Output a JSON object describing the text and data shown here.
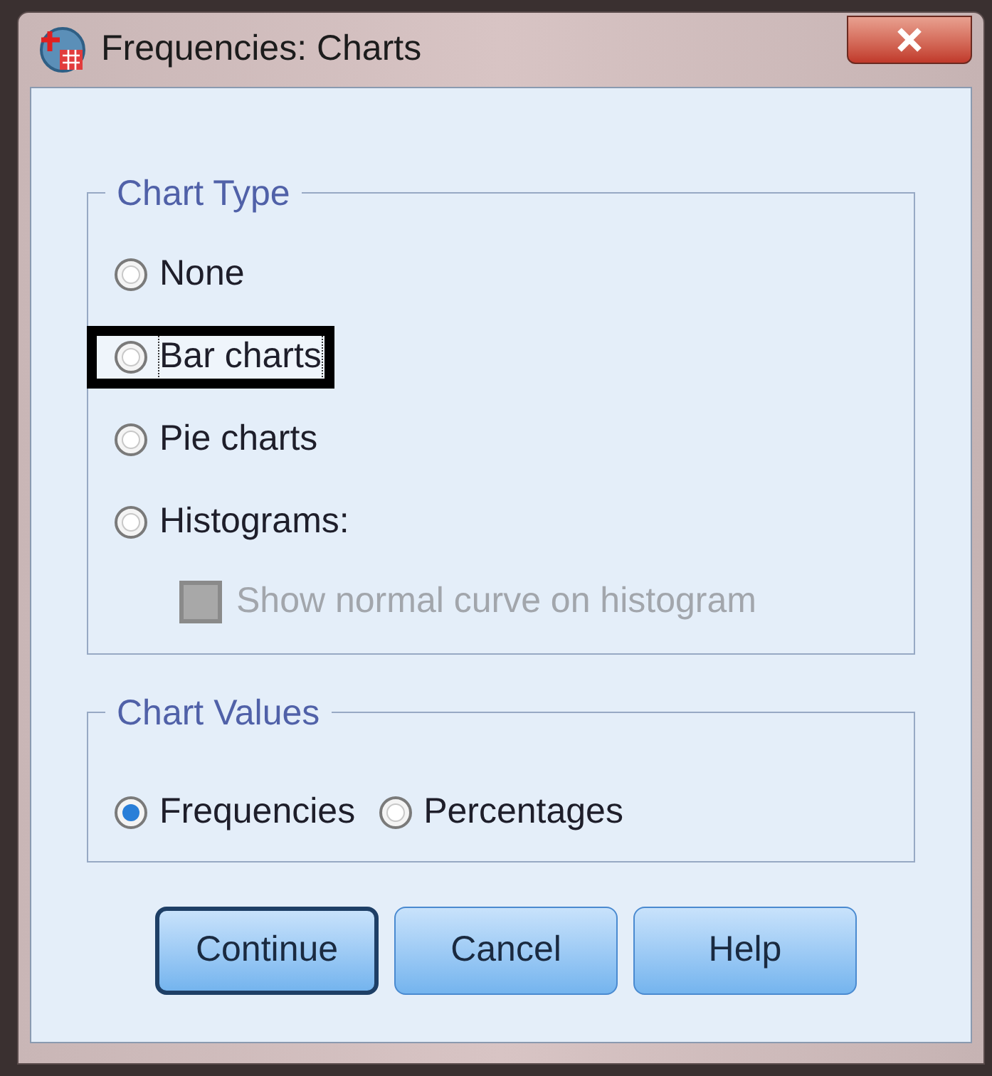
{
  "window": {
    "title": "Frequencies: Charts"
  },
  "chart_type": {
    "legend": "Chart Type",
    "options": [
      {
        "label": "None",
        "selected": false,
        "focused": false,
        "highlighted": false
      },
      {
        "label": "Bar charts",
        "selected": false,
        "focused": true,
        "highlighted": true
      },
      {
        "label": "Pie charts",
        "selected": false,
        "focused": false,
        "highlighted": false
      },
      {
        "label": "Histograms:",
        "selected": false,
        "focused": false,
        "highlighted": false
      }
    ],
    "normal_curve": {
      "label": "Show normal curve on histogram",
      "checked": false,
      "disabled": true
    }
  },
  "chart_values": {
    "legend": "Chart Values",
    "options": [
      {
        "label": "Frequencies",
        "selected": true
      },
      {
        "label": "Percentages",
        "selected": false
      }
    ]
  },
  "buttons": [
    {
      "label": "Continue",
      "default": true
    },
    {
      "label": "Cancel",
      "default": false
    },
    {
      "label": "Help",
      "default": false
    }
  ]
}
